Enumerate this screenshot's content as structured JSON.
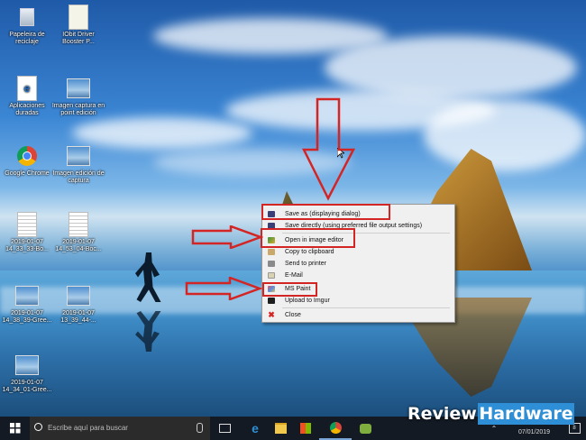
{
  "desktop": {
    "icons": [
      {
        "label": "Papeleira de reciclaje",
        "icon": "recycle-bin-icon"
      },
      {
        "label": "IObit Driver Booster P...",
        "icon": "shortcut-icon"
      },
      {
        "label": "Aplicaciones duradas",
        "icon": "edge-icon"
      },
      {
        "label": "Imagen captura en point edición",
        "icon": "screenshot-thumb-icon"
      },
      {
        "label": "Google Chrome",
        "icon": "chrome-icon"
      },
      {
        "label": "Imagen edición de captura",
        "icon": "screenshot-thumb-icon"
      },
      {
        "label": "2019-01-07 14_33_33-Bo...",
        "icon": "document-thumb-icon"
      },
      {
        "label": "2019-01-07 14_53_04-Boc...",
        "icon": "document-thumb-icon"
      },
      {
        "label": "2019-01-07 14_38_39-Gree...",
        "icon": "screenshot-thumb-icon"
      },
      {
        "label": "2019-01-07 13_39_44-...",
        "icon": "screenshot-thumb-icon"
      },
      {
        "label": "2019-01-07 14_34_01-Gree...",
        "icon": "screenshot-thumb-icon"
      }
    ]
  },
  "context_menu": {
    "items": [
      {
        "label": "Save as (displaying dialog)",
        "icon": "save-icon"
      },
      {
        "label": "Save directly (using preferred file output settings)",
        "icon": "save-icon"
      },
      {
        "label": "Open in image editor",
        "icon": "image-editor-icon"
      },
      {
        "label": "Copy to clipboard",
        "icon": "clipboard-icon"
      },
      {
        "label": "Send to printer",
        "icon": "printer-icon"
      },
      {
        "label": "E-Mail",
        "icon": "email-icon"
      },
      {
        "label": "MS Paint",
        "icon": "paint-icon"
      },
      {
        "label": "Upload to Imgur",
        "icon": "imgur-icon"
      },
      {
        "label": "Close",
        "icon": "close-icon"
      }
    ]
  },
  "taskbar": {
    "search_placeholder": "Escribe aquí para buscar",
    "date": "07/01/2019",
    "notification_count": "8"
  },
  "watermark": {
    "left": "Review",
    "right": "Hardware"
  },
  "colors": {
    "highlight": "#d42525",
    "taskbar": "#131a24",
    "brand_box": "#2f8fd6"
  }
}
